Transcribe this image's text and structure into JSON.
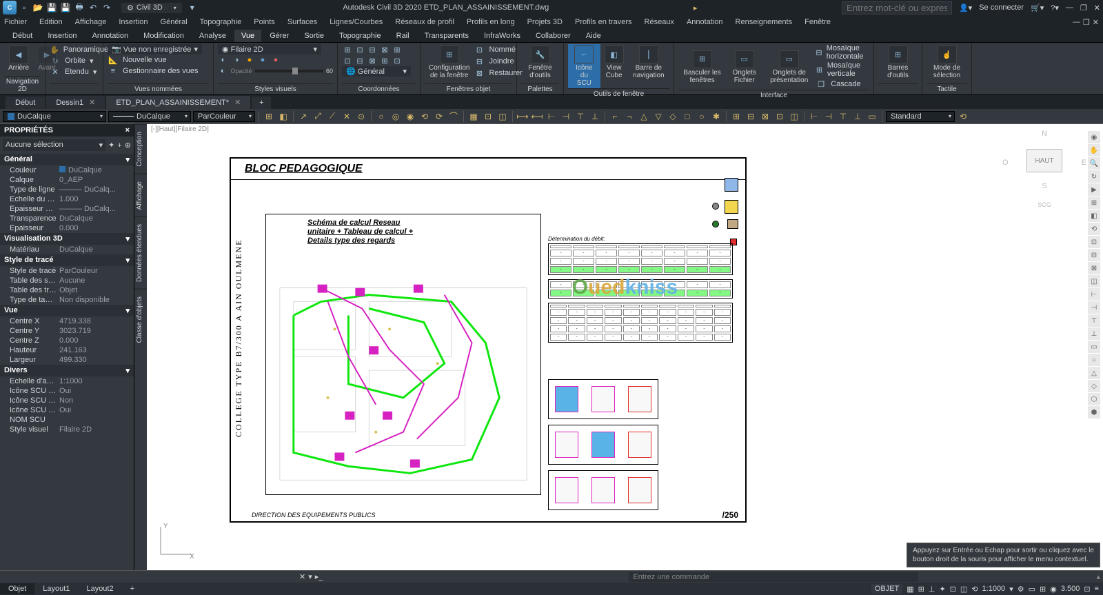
{
  "qat": {
    "workspace": "Civil 3D",
    "title": "Autodesk Civil 3D 2020   ETD_PLAN_ASSAINISSEMENT.dwg",
    "search_placeholder": "Entrez mot-clé ou expression",
    "signin": "Se connecter"
  },
  "menu": [
    "Fichier",
    "Edition",
    "Affichage",
    "Insertion",
    "Général",
    "Topographie",
    "Points",
    "Surfaces",
    "Lignes/Courbes",
    "Réseaux de profil",
    "Profils en long",
    "Projets 3D",
    "Profils en travers",
    "Réseaux",
    "Annotation",
    "Renseignements",
    "Fenêtre"
  ],
  "ribtabs": [
    "Début",
    "Insertion",
    "Annotation",
    "Modification",
    "Analyse",
    "Vue",
    "Gérer",
    "Sortie",
    "Topographie",
    "Rail",
    "Transparents",
    "InfraWorks",
    "Collaborer",
    "Aide"
  ],
  "ribActive": "Vue",
  "ribbon": {
    "nav_back": "Arrière",
    "nav_fwd": "Avant",
    "panoramique": "Panoramique",
    "orbite": "Orbite",
    "etendu": "Etendu",
    "vue_non": "Vue non enregistrée",
    "nouvelle": "Nouvelle vue",
    "gest": "Gestionnaire des vues",
    "filaire": "Filaire 2D",
    "opacite": "Opacité",
    "opval": "60",
    "general": "Général",
    "config": "Configuration de la fenêtre",
    "nomme": "Nommé",
    "joindre": "Joindre",
    "restaurer": "Restaurer",
    "fen_outils": "Fenêtre d'outils",
    "icone_scu": "Icône du SCU",
    "viewcube": "View Cube",
    "barre_nav": "Barre de navigation",
    "basculer": "Basculer les fenêtres",
    "onglets_f": "Onglets Fichier",
    "onglets_p": "Onglets de présentation",
    "mos_h": "Mosaïque horizontale",
    "mos_v": "Mosaïque verticale",
    "cascade": "Cascade",
    "barres": "Barres d'outils",
    "mode_sel": "Mode de sélection",
    "caps": {
      "nav": "Navigation 2D",
      "vues": "Vues nommées",
      "styles": "Styles visuels",
      "coord": "Coordonnées",
      "fen": "Fenêtres objet",
      "pal": "Palettes",
      "scu": "Outils de fenêtre",
      "iface": "Interface",
      "tac": "Tactile"
    }
  },
  "doctabs": [
    {
      "label": "Début",
      "close": false
    },
    {
      "label": "Dessin1",
      "close": true,
      "active": false
    },
    {
      "label": "ETD_PLAN_ASSAINISSEMENT*",
      "close": true,
      "active": true
    }
  ],
  "layerbar": {
    "combo1": "DuCalque",
    "combo2": "DuCalque",
    "combo3": "ParCouleur",
    "std": "Standard"
  },
  "props": {
    "title": "PROPRIÉTÉS",
    "sel": "Aucune sélection",
    "groups": [
      {
        "name": "Général",
        "rows": [
          {
            "k": "Couleur",
            "v": "DuCalque",
            "sw": "#2d6ea8"
          },
          {
            "k": "Calque",
            "v": "0_AEP"
          },
          {
            "k": "Type de ligne",
            "v": "——— DuCalq..."
          },
          {
            "k": "Echelle du ty...",
            "v": "1.000"
          },
          {
            "k": "Epaisseur de...",
            "v": "——— DuCalq..."
          },
          {
            "k": "Transparence",
            "v": "DuCalque"
          },
          {
            "k": "Epaisseur",
            "v": "0.000"
          }
        ]
      },
      {
        "name": "Visualisation 3D",
        "rows": [
          {
            "k": "Matériau",
            "v": "DuCalque"
          }
        ]
      },
      {
        "name": "Style de tracé",
        "rows": [
          {
            "k": "Style de tracé",
            "v": "ParCouleur"
          },
          {
            "k": "Table des styl...",
            "v": "Aucune"
          },
          {
            "k": "Table des tra...",
            "v": "Objet"
          },
          {
            "k": "Type de tabl...",
            "v": "Non disponible"
          }
        ]
      },
      {
        "name": "Vue",
        "rows": [
          {
            "k": "Centre X",
            "v": "4719.338"
          },
          {
            "k": "Centre Y",
            "v": "3023.719"
          },
          {
            "k": "Centre Z",
            "v": "0.000"
          },
          {
            "k": "Hauteur",
            "v": "241.163"
          },
          {
            "k": "Largeur",
            "v": "499.330"
          }
        ]
      },
      {
        "name": "Divers",
        "rows": [
          {
            "k": "Echelle d'ann...",
            "v": "1:1000"
          },
          {
            "k": "Icône SCU ac...",
            "v": "Oui"
          },
          {
            "k": "Icône SCU au...",
            "v": "Non"
          },
          {
            "k": "Icône SCU pa...",
            "v": "Oui"
          },
          {
            "k": "NOM SCU",
            "v": ""
          },
          {
            "k": "Style visuel",
            "v": "Filaire 2D"
          }
        ]
      }
    ]
  },
  "sidetabs": [
    "Conception",
    "Affichage",
    "Données étendues",
    "Classe d'objets"
  ],
  "viewport": {
    "label": "[-][Haut][Filaire 2D]",
    "cube": "HAUT",
    "scg": "SCG"
  },
  "drawing": {
    "title": "BLOC PEDAGOGIQUE",
    "vtext": "COLLEGE TYPE B7/300 A AIN OULMENE",
    "sub1": "Schéma de calcul Reseau",
    "sub2": "unitaire + Tableau de calcul +",
    "sub3": "Details type des regards",
    "footer": "DIRECTION DES EQUIPEMENTS PUBLICS",
    "page": "/250",
    "tbl1_title": "Détermination du débit:"
  },
  "cmd": {
    "hint1": "Appuyez sur Entrée ou Echap pour sortir ou cliquez avec le",
    "hint2": "bouton droit de la souris pour afficher le menu contextuel.",
    "placeholder": "Entrez une commande"
  },
  "layout_tabs": [
    "Objet",
    "Layout1",
    "Layout2"
  ],
  "status": {
    "mode": "OBJET",
    "scale": "1:1000",
    "coord": "3.500"
  }
}
